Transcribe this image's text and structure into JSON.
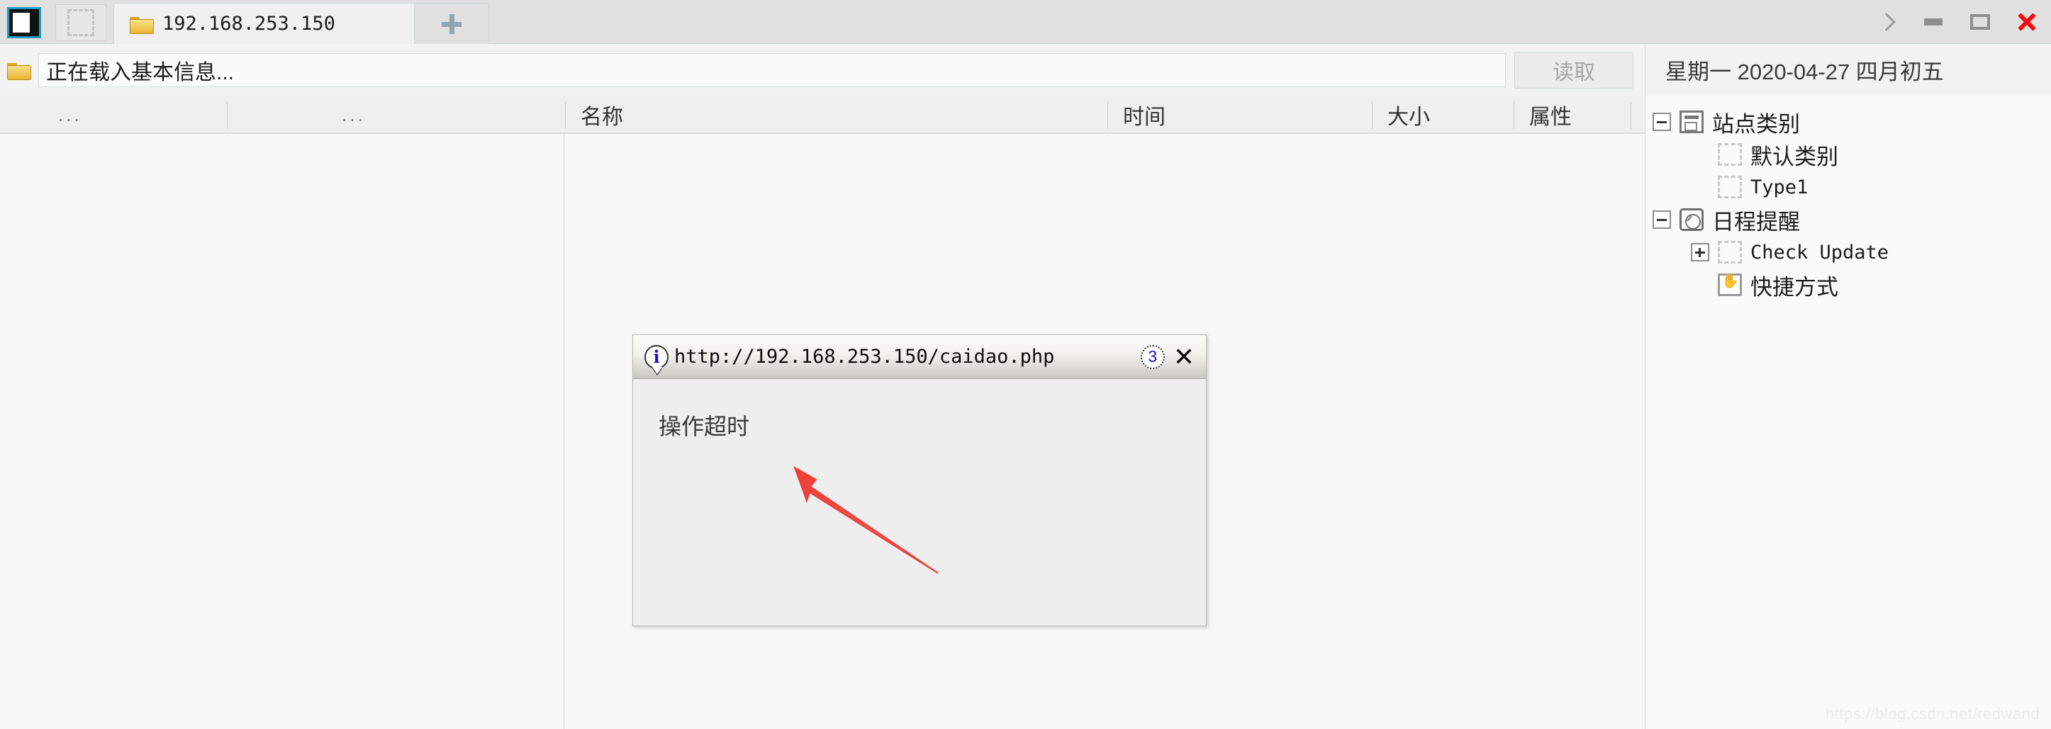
{
  "window": {
    "controls": {
      "chevron": "chevron-right",
      "minimize": "minimize",
      "maximize": "maximize",
      "close": "close"
    }
  },
  "tabbar": {
    "panel_toggle_icon": "panel-icon",
    "placeholder_icon": "dashed-placeholder-icon",
    "tabs": [
      {
        "icon": "folder-icon",
        "label": "192.168.253.150"
      }
    ],
    "new_tab_label": "+"
  },
  "addressbar": {
    "folder_icon": "folder-icon",
    "value": "正在载入基本信息...",
    "placeholder": "正在载入基本信息...",
    "read_button_label": "读取",
    "read_button_disabled": true
  },
  "datebar": {
    "text": "星期一 2020-04-27 四月初五"
  },
  "columns": [
    {
      "label": "...",
      "kind": "dots"
    },
    {
      "label": "...",
      "kind": "dots"
    },
    {
      "label": "名称",
      "kind": "text"
    },
    {
      "label": "时间",
      "kind": "text"
    },
    {
      "label": "大小",
      "kind": "text"
    },
    {
      "label": "属性",
      "kind": "text"
    }
  ],
  "tree": {
    "nodes": [
      {
        "label": "站点类别",
        "expander": "minus",
        "icon": "window-icon",
        "level": 0,
        "mono": false
      },
      {
        "label": "默认类别",
        "expander": "none",
        "icon": "dashed-icon",
        "level": 1,
        "mono": false
      },
      {
        "label": "Type1",
        "expander": "none",
        "icon": "dashed-icon",
        "level": 1,
        "mono": true
      },
      {
        "label": "日程提醒",
        "expander": "minus",
        "icon": "clock-icon",
        "level": 0,
        "mono": false
      },
      {
        "label": "Check Update",
        "expander": "plus",
        "icon": "dashed-icon",
        "level": 1,
        "mono": true
      },
      {
        "label": "快捷方式",
        "expander": "none",
        "icon": "hand-icon",
        "level": 0,
        "mono": false
      }
    ]
  },
  "dialog": {
    "info_icon": "info-icon",
    "title": "http://192.168.253.150/caidao.php",
    "badge": "3",
    "close_label": "✕",
    "message": "操作超时",
    "annotation": {
      "type": "arrow",
      "color": "#ef3b35"
    }
  },
  "watermark": {
    "text": "https://blog.csdn.net/redwand"
  },
  "colors": {
    "accent_teal": "#1a9bbf",
    "close_red": "#f40c0c",
    "arrow_red": "#ef3b35",
    "folder_yellow": "#e8b533"
  }
}
